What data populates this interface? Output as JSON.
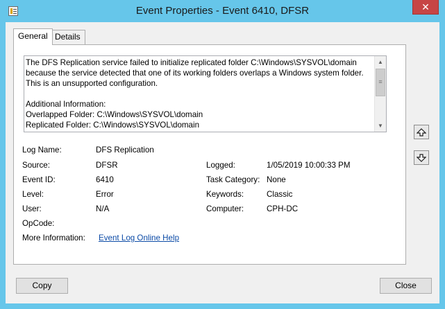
{
  "window": {
    "title": "Event Properties - Event 6410, DFSR",
    "close_label": "✕"
  },
  "tabs": [
    {
      "label": "General",
      "active": true
    },
    {
      "label": "Details",
      "active": false
    }
  ],
  "description": "The DFS Replication service failed to initialize replicated folder C:\\Windows\\SYSVOL\\domain because the service detected that one of its working folders overlaps a Windows system folder. This is an unsupported configuration.\n\nAdditional Information:\nOverlapped Folder: C:\\Windows\\SYSVOL\\domain\nReplicated Folder: C:\\Windows\\SYSVOL\\domain\nReplicated Folder Name: SYSVOL Share",
  "fields": {
    "log_name": {
      "label": "Log Name:",
      "value": "DFS Replication"
    },
    "source": {
      "label": "Source:",
      "value": "DFSR"
    },
    "logged": {
      "label": "Logged:",
      "value": "1/05/2019 10:00:33 PM"
    },
    "event_id": {
      "label": "Event ID:",
      "value": "6410"
    },
    "task_category": {
      "label": "Task Category:",
      "value": "None"
    },
    "level": {
      "label": "Level:",
      "value": "Error"
    },
    "keywords": {
      "label": "Keywords:",
      "value": "Classic"
    },
    "user": {
      "label": "User:",
      "value": "N/A"
    },
    "computer": {
      "label": "Computer:",
      "value": "CPH-DC"
    },
    "opcode": {
      "label": "OpCode:",
      "value": ""
    },
    "more_info": {
      "label": "More Information:",
      "link": "Event Log Online Help"
    }
  },
  "buttons": {
    "copy": "Copy",
    "close": "Close"
  },
  "icons": {
    "scroll_up": "arrow-up-icon",
    "scroll_down": "arrow-down-icon",
    "prev_event": "arrow-up-icon",
    "next_event": "arrow-down-icon"
  }
}
